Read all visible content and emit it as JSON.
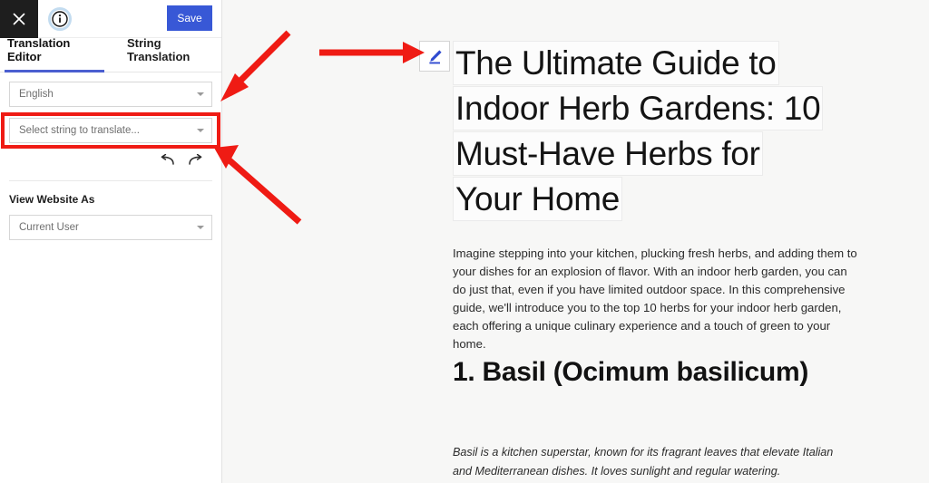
{
  "sidebar": {
    "topbar": {
      "close_icon": "close-x-icon",
      "info_icon": "info-circle-icon",
      "save_label": "Save",
      "save_color": "#3858d6"
    },
    "tabs": [
      {
        "label": "Translation Editor",
        "active": true
      },
      {
        "label": "String Translation",
        "active": false
      }
    ],
    "language_select": {
      "value": "English",
      "caret_icon": "chevron-down-icon"
    },
    "string_select": {
      "placeholder": "Select string to translate...",
      "value": "Select string to translate...",
      "caret_icon": "chevron-down-icon",
      "highlight_color": "#ef1b14"
    },
    "history": {
      "undo_icon": "undo-arrow-icon",
      "redo_icon": "redo-arrow-icon"
    },
    "view_website_as": {
      "label": "View Website As",
      "value": "Current User",
      "caret_icon": "chevron-down-icon"
    }
  },
  "content": {
    "edit_button": {
      "icon": "pencil-edit-icon",
      "icon_color": "#2f4ad0"
    },
    "headline_lines": [
      "The Ultimate Guide to",
      "Indoor Herb Gardens: 10",
      "Must-Have Herbs for",
      "Your Home"
    ],
    "intro_paragraph": "Imagine stepping into your kitchen, plucking fresh herbs, and adding them to your dishes for an explosion of flavor. With an indoor herb garden, you can do just that, even if you have limited outdoor space. In this comprehensive guide, we'll introduce you to the top 10 herbs for your indoor herb garden, each offering a unique culinary experience and a touch of green to your home.",
    "section_heading": "1. Basil (Ocimum basilicum)",
    "section_paragraph": "Basil is a kitchen superstar, known for its fragrant leaves that elevate Italian and Mediterranean dishes. It loves sunlight and regular watering."
  },
  "annotations": {
    "color": "#ef1b14",
    "arrows": [
      {
        "name": "arrow-to-string-select",
        "desc": "diagonal arrow pointing down-left to string select"
      },
      {
        "name": "arrow-to-edit-pencil",
        "desc": "horizontal arrow pointing right to pencil button"
      },
      {
        "name": "arrow-to-redo",
        "desc": "diagonal arrow pointing up-left to redo button"
      }
    ]
  }
}
